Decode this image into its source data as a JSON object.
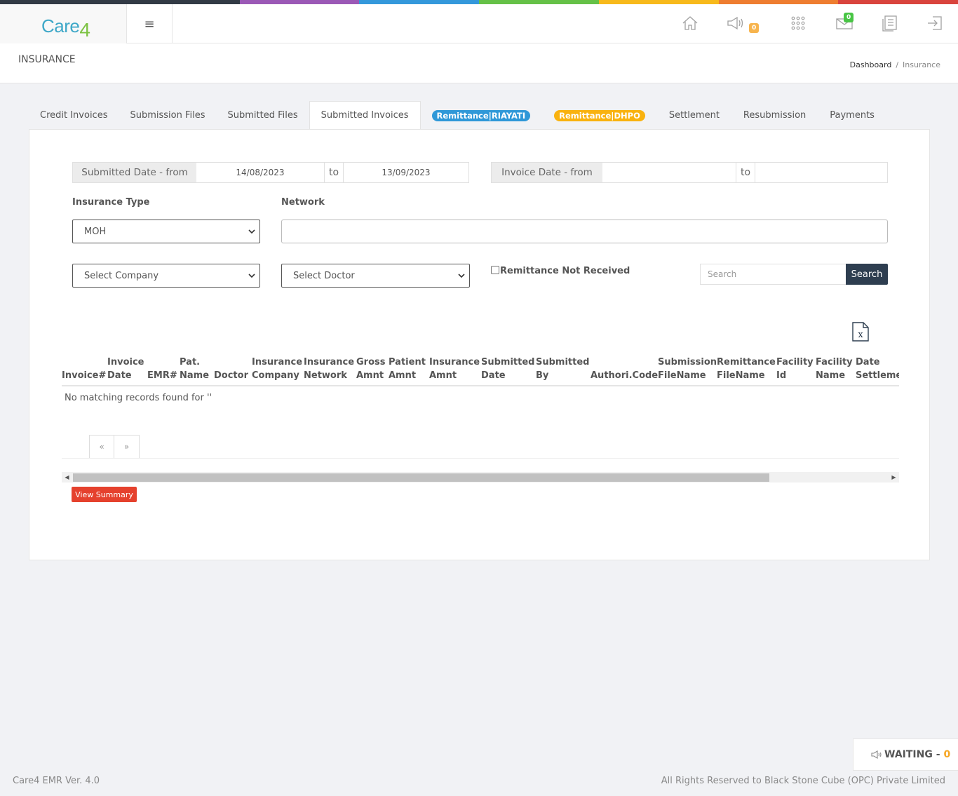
{
  "strip_colors": [
    "#323a45",
    "#323a45",
    "#9b59b6",
    "#3498db",
    "#65c147",
    "#f7b91b",
    "#ee7d30",
    "#d9443d"
  ],
  "logo": {
    "text": "Care",
    "suffix": "4"
  },
  "header_icons": [
    {
      "name": "home-icon"
    },
    {
      "name": "megaphone-icon",
      "badge": "0",
      "badge_color": "#f7b44d"
    },
    {
      "name": "apps-grid-icon"
    },
    {
      "name": "mail-icon",
      "badge": "0",
      "badge_color": "#48c544"
    },
    {
      "name": "documents-icon"
    },
    {
      "name": "logout-icon"
    }
  ],
  "page": {
    "title": "INSURANCE"
  },
  "breadcrumb": {
    "home": "Dashboard",
    "separator": "/",
    "current": "Insurance"
  },
  "tabs": [
    {
      "label": "Credit Invoices"
    },
    {
      "label": "Submission Files"
    },
    {
      "label": "Submitted Files"
    },
    {
      "label": "Submitted Invoices",
      "active": true
    },
    {
      "label": "Remittance|RIAYATI",
      "pill": "blue"
    },
    {
      "label": "Remittance|DHPO",
      "pill": "yellow"
    },
    {
      "label": "Settlement"
    },
    {
      "label": "Resubmission"
    },
    {
      "label": "Payments"
    }
  ],
  "filters": {
    "submitted_date": {
      "label": "Submitted Date - from",
      "from": "14/08/2023",
      "to_label": "to",
      "to": "13/09/2023"
    },
    "invoice_date": {
      "label": "Invoice Date - from",
      "from": "",
      "to_label": "to",
      "to": ""
    },
    "insurance_type": {
      "label": "Insurance Type",
      "value": "MOH"
    },
    "network": {
      "label": "Network",
      "value": ""
    },
    "company": {
      "value": "Select Company"
    },
    "doctor": {
      "value": "Select Doctor"
    },
    "remittance_not_received": {
      "label": "Remittance Not Received",
      "checked": false
    },
    "search": {
      "placeholder": "Search",
      "button": "Search"
    }
  },
  "table": {
    "columns": [
      [
        "Invoice#"
      ],
      [
        "Invoice",
        "Date"
      ],
      [
        "EMR#"
      ],
      [
        "Pat.",
        "Name"
      ],
      [
        "Doctor"
      ],
      [
        "Insurance",
        "Company"
      ],
      [
        "Insurance",
        "Network"
      ],
      [
        "Gross",
        "Amnt"
      ],
      [
        "Patient",
        "Amnt"
      ],
      [
        "Insurance",
        "Amnt"
      ],
      [
        "Submitted",
        "Date"
      ],
      [
        "Submitted",
        "By"
      ],
      [
        "Authori.Code"
      ],
      [
        "Submission",
        "FileName"
      ],
      [
        "Remittance",
        "FileName"
      ],
      [
        "Facility",
        "Id"
      ],
      [
        "Facility",
        "Name"
      ],
      [
        "Date",
        "Settlement"
      ]
    ],
    "empty_message": "No matching records found for ''"
  },
  "pager": {
    "prev": "«",
    "next": "»"
  },
  "view_summary": "View Summary",
  "waiting": {
    "label": "WAITING -",
    "count": "0"
  },
  "footer": {
    "version": "Care4 EMR Ver. 4.0",
    "copyright": "All Rights Reserved to Black Stone Cube (OPC) Private Limited"
  }
}
